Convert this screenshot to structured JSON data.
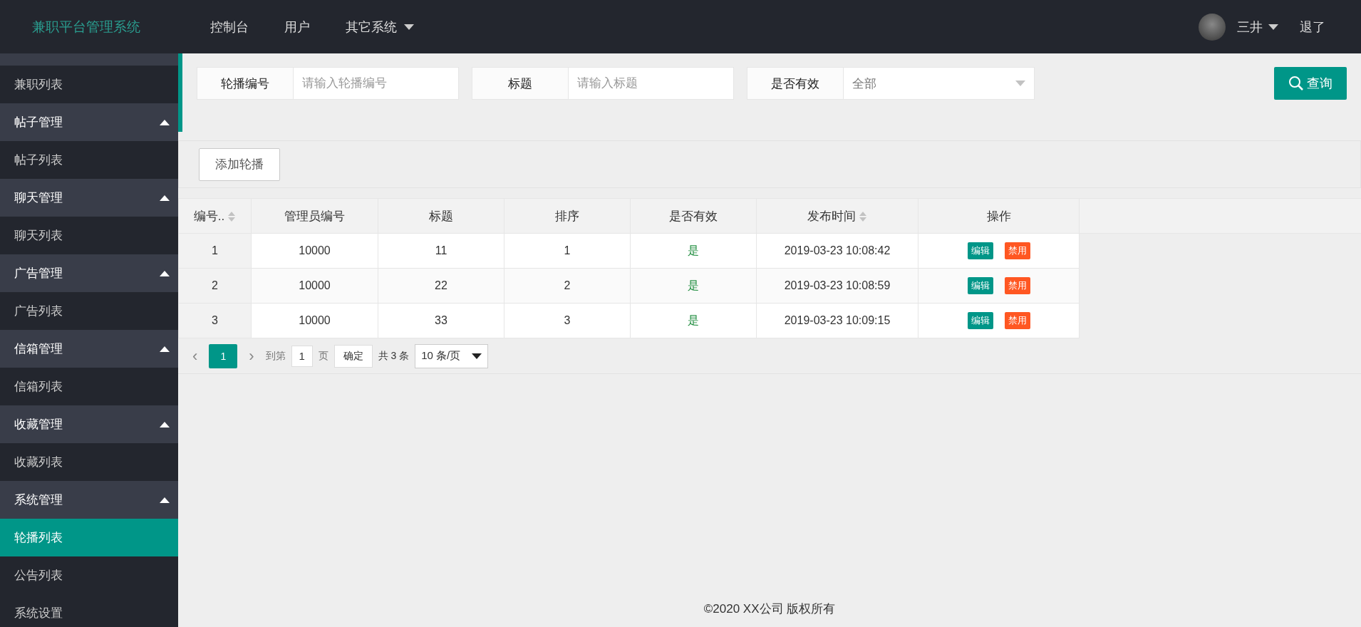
{
  "header": {
    "logo": "兼职平台管理系统",
    "nav": [
      {
        "label": "控制台",
        "has_menu": false
      },
      {
        "label": "用户",
        "has_menu": false
      },
      {
        "label": "其它系统",
        "has_menu": true
      }
    ],
    "user": {
      "name": "三井",
      "has_menu": true
    },
    "logout": "退了"
  },
  "sidebar": {
    "items": [
      {
        "kind": "link",
        "label": "兼职列表",
        "selected": false
      },
      {
        "kind": "group",
        "label": "帖子管理",
        "expanded": true,
        "children": [
          {
            "label": "帖子列表",
            "selected": false
          }
        ]
      },
      {
        "kind": "group",
        "label": "聊天管理",
        "expanded": true,
        "children": [
          {
            "label": "聊天列表",
            "selected": false
          }
        ]
      },
      {
        "kind": "group",
        "label": "广告管理",
        "expanded": true,
        "children": [
          {
            "label": "广告列表",
            "selected": false
          }
        ]
      },
      {
        "kind": "group",
        "label": "信箱管理",
        "expanded": true,
        "children": [
          {
            "label": "信箱列表",
            "selected": false
          }
        ]
      },
      {
        "kind": "group",
        "label": "收藏管理",
        "expanded": true,
        "children": [
          {
            "label": "收藏列表",
            "selected": false
          }
        ]
      },
      {
        "kind": "group",
        "label": "系统管理",
        "expanded": true,
        "children": [
          {
            "label": "轮播列表",
            "selected": true
          },
          {
            "label": "公告列表",
            "selected": false
          },
          {
            "label": "系统设置",
            "selected": false
          }
        ]
      }
    ]
  },
  "filters": [
    {
      "kind": "text",
      "label": "轮播编号",
      "placeholder": "请输入轮播编号"
    },
    {
      "kind": "text",
      "label": "标题",
      "placeholder": "请输入标题"
    },
    {
      "kind": "select",
      "label": "是否有效",
      "value": "全部"
    }
  ],
  "search_button": "查询",
  "add_button": "添加轮播",
  "table": {
    "columns": [
      {
        "label": "编号..",
        "sortable": true
      },
      {
        "label": "管理员编号",
        "sortable": false
      },
      {
        "label": "标题",
        "sortable": false
      },
      {
        "label": "排序",
        "sortable": false
      },
      {
        "label": "是否有效",
        "sortable": false
      },
      {
        "label": "发布时间",
        "sortable": true
      },
      {
        "label": "操作",
        "sortable": false
      }
    ],
    "rows": [
      {
        "id": "1",
        "admin": "10000",
        "title": "11",
        "order": "1",
        "valid": "是",
        "time": "2019-03-23 10:08:42",
        "actions": [
          {
            "kind": "edit",
            "label": "编辑"
          },
          {
            "kind": "disable",
            "label": "禁用"
          }
        ]
      },
      {
        "id": "2",
        "admin": "10000",
        "title": "22",
        "order": "2",
        "valid": "是",
        "time": "2019-03-23 10:08:59",
        "actions": [
          {
            "kind": "edit",
            "label": "编辑"
          },
          {
            "kind": "disable",
            "label": "禁用"
          }
        ]
      },
      {
        "id": "3",
        "admin": "10000",
        "title": "33",
        "order": "3",
        "valid": "是",
        "time": "2019-03-23 10:09:15",
        "actions": [
          {
            "kind": "edit",
            "label": "编辑"
          },
          {
            "kind": "disable",
            "label": "禁用"
          }
        ]
      }
    ]
  },
  "pagination": {
    "prev": "‹",
    "pages": [
      {
        "label": "1",
        "selected": true
      }
    ],
    "next": "›",
    "goto_label": "到第",
    "goto_value": "1",
    "page_unit": "页",
    "confirm": "确定",
    "total": "共 3 条",
    "page_size": "10 条/页"
  },
  "footer": "©2020 XX公司 版权所有"
}
